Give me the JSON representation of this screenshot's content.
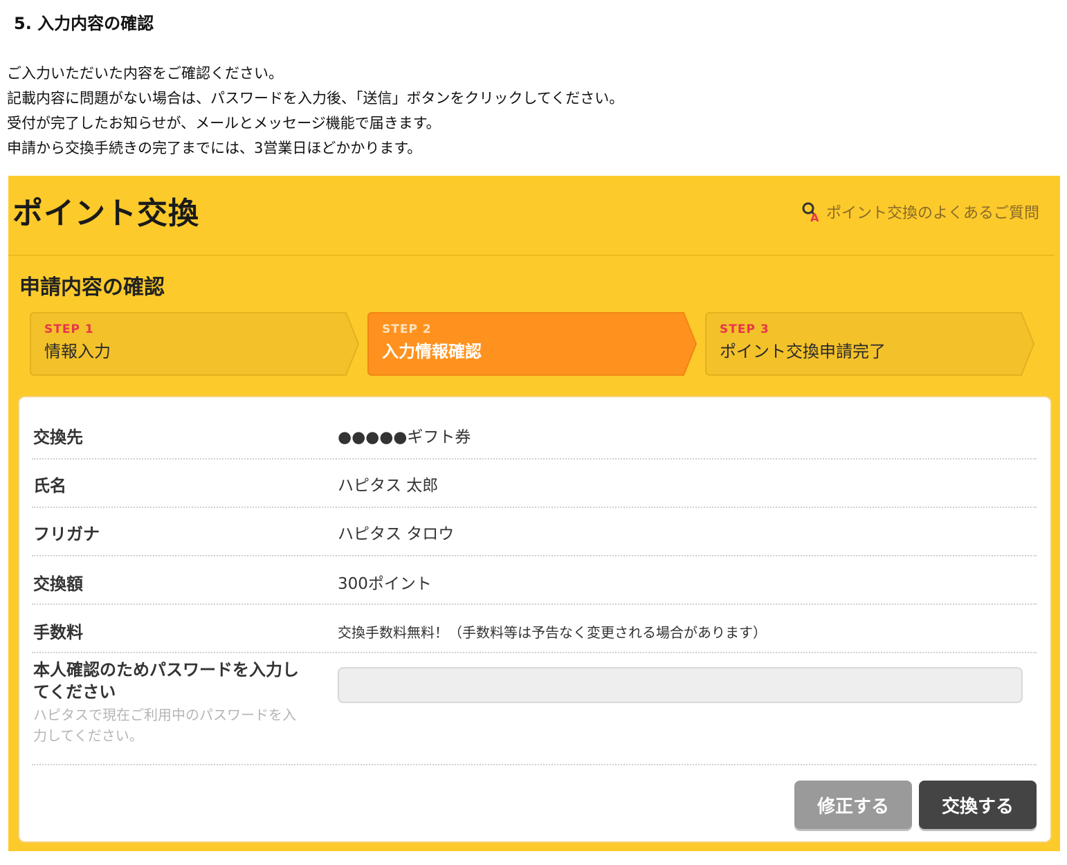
{
  "section_title": "5. 入力内容の確認",
  "intro_lines": [
    "ご入力いただいた内容をご確認ください。",
    "記載内容に問題がない場合は、パスワードを入力後、「送信」ボタンをクリックしてください。",
    "受付が完了したお知らせが、メールとメッセージ機能で届きます。",
    "申請から交換手続きの完了までには、3営業日ほどかかります。"
  ],
  "panel": {
    "title": "ポイント交換",
    "faq_link": "ポイント交換のよくあるご質問",
    "sub_title": "申請内容の確認",
    "steps": [
      {
        "num": "STEP 1",
        "label": "情報入力"
      },
      {
        "num": "STEP 2",
        "label": "入力情報確認"
      },
      {
        "num": "STEP 3",
        "label": "ポイント交換申請完了"
      }
    ]
  },
  "form": {
    "rows": [
      {
        "label": "交換先",
        "value": "●●●●●ギフト券"
      },
      {
        "label": "氏名",
        "value": "ハピタス 太郎"
      },
      {
        "label": "フリガナ",
        "value": "ハピタス タロウ"
      },
      {
        "label": "交換額",
        "value": "300ポイント"
      },
      {
        "label": "手数料",
        "value": "交換手数料無料！（手数料等は予告なく変更される場合があります）"
      }
    ],
    "password_label": "本人確認のためパスワードを入力してください",
    "password_hint": "ハピタスで現在ご利用中のパスワードを入力してください。",
    "password_value": "",
    "edit_button": "修正する",
    "exchange_button": "交換する"
  },
  "colors": {
    "panel_bg": "#fcca2b",
    "active_step": "#ff921e",
    "inactive_step": "#f3c12a",
    "edit_button": "#9a9a9a",
    "exchange_button": "#444444"
  }
}
